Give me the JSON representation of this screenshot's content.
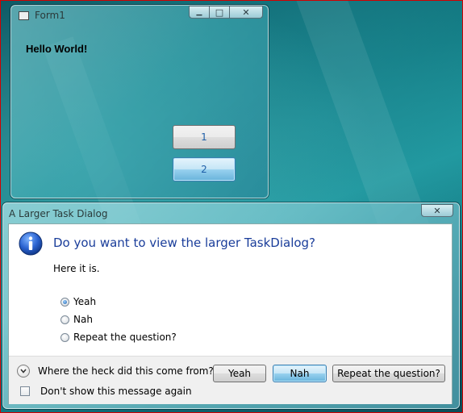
{
  "form1": {
    "title": "Form1",
    "greeting": "Hello World!",
    "button1_label": "1",
    "button2_label": "2",
    "minimize_glyph": "▁",
    "maximize_glyph": "□",
    "close_glyph": "✕"
  },
  "task_dialog": {
    "title": "A Larger Task Dialog",
    "close_glyph": "✕",
    "main_instruction": "Do you want to view the larger TaskDialog?",
    "content": "Here it is.",
    "radio_options": [
      {
        "label": "Yeah",
        "checked": true
      },
      {
        "label": "Nah",
        "checked": false
      },
      {
        "label": "Repeat the question?",
        "checked": false
      }
    ],
    "expander_label": "Where the heck did this come from?",
    "buttons": {
      "yeah": "Yeah",
      "nah": "Nah",
      "repeat": "Repeat the question?"
    },
    "verification_label": "Don't show this message again",
    "icon": "information-icon"
  },
  "colors": {
    "instruction_text": "#1a3d9a",
    "button_text_form": "#1f5fa8",
    "default_button_border": "#3c7fb1",
    "screenshot_border": "#d20000"
  }
}
